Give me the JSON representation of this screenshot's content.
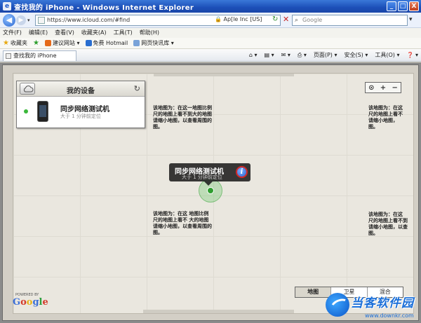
{
  "window": {
    "title": "查找我的 iPhone - Windows Internet Explorer",
    "controls": [
      "_",
      "□",
      "X"
    ]
  },
  "address": {
    "url": "https://www.icloud.com/#find",
    "lock_text": "Ap[le Inc [US]",
    "search_placeholder": "Google"
  },
  "menu": [
    "文件(F)",
    "编辑(E)",
    "查看(V)",
    "收藏夹(A)",
    "工具(T)",
    "帮助(H)"
  ],
  "favorites": {
    "label": "收藏夹",
    "items": [
      "建议网站 ▾",
      "免费 Hotmail",
      "网页快讯库 ▾"
    ]
  },
  "tab": {
    "label": "查找我的 iPhone"
  },
  "commands": [
    "页面(P) ▾",
    "安全(S) ▾",
    "工具(O) ▾",
    "❓ ▾"
  ],
  "device_panel": {
    "title": "我的设备",
    "device_name": "同步网络测试机",
    "device_status": "大于 1 分钟前定位"
  },
  "callout": {
    "title": "同步网络测试机",
    "subtitle": "大于 1 分钟前定位",
    "info": "i"
  },
  "zoom": {
    "locate": "⊙",
    "plus": "+",
    "minus": "−"
  },
  "map_texts": [
    "该地图为：在这一地图比例\n尺的地图上看不到大的地图\n请缩小地图，以查看周围的\n图。",
    "该地图为：在这\n尺的地图上看不\n请缩小地图，\n图。",
    "该地图为：在这 地图比例\n尺的地图上看不 大的地图\n请缩小地图，以查看周围的\n图。",
    "该地图为：在这\n尺的地图上看不到\n请缩小地图，以查\n图。"
  ],
  "map_types": [
    "地图",
    "卫星",
    "混合"
  ],
  "google": {
    "powered": "POWERED BY",
    "letters": [
      "G",
      "o",
      "o",
      "g",
      "l",
      "e"
    ],
    "colors": [
      "#3b6fd8",
      "#d43a2a",
      "#e8b31c",
      "#3b6fd8",
      "#2c9e3c",
      "#d43a2a"
    ]
  },
  "watermark": {
    "text": "当客软件园",
    "url": "www.downkr.com"
  }
}
